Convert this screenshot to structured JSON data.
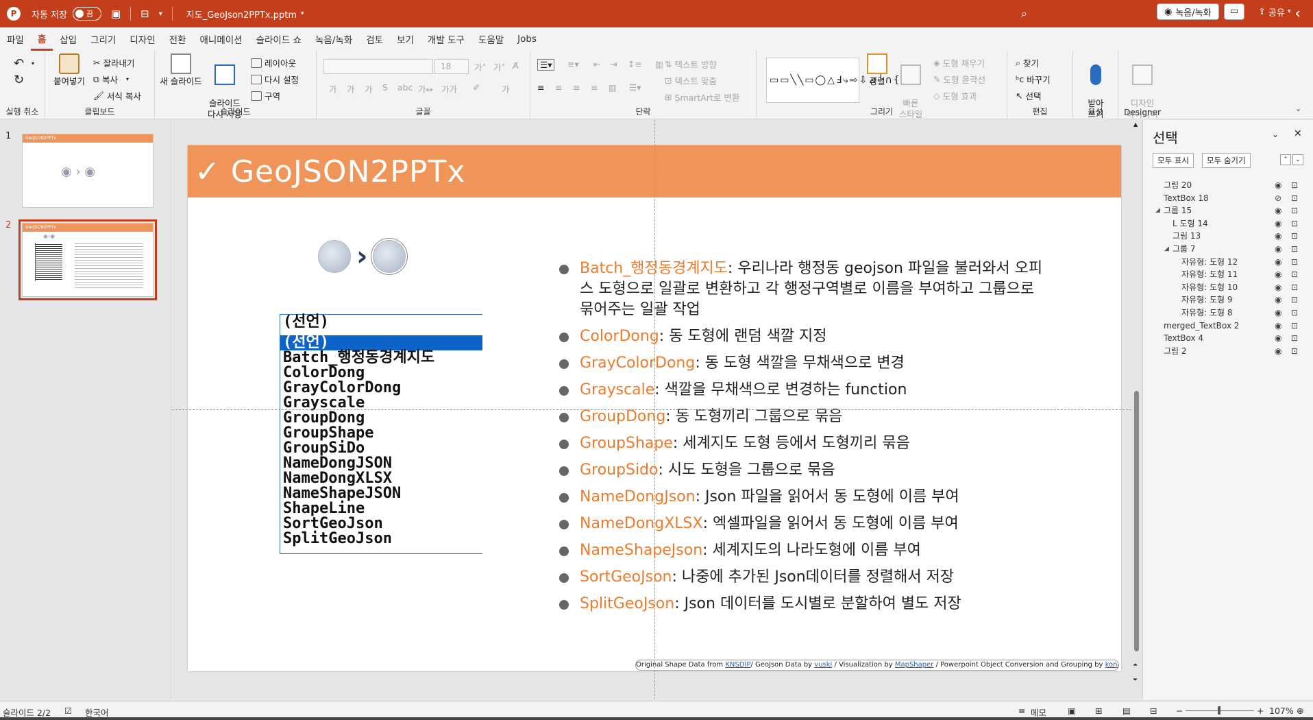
{
  "titlebar": {
    "autosave_label": "자동 저장",
    "toggle_state": "끔",
    "filename": "지도_GeoJson2PPTx.pptm"
  },
  "menu": {
    "tabs": [
      "파일",
      "홈",
      "삽입",
      "그리기",
      "디자인",
      "전환",
      "애니메이션",
      "슬라이드 쇼",
      "녹음/녹화",
      "검토",
      "보기",
      "개발 도구",
      "도움말",
      "Jobs"
    ],
    "active": "홈",
    "record_button": "녹음/녹화",
    "share_button": "공유"
  },
  "ribbon": {
    "undo_group": "실행 취소",
    "clipboard": {
      "label": "클립보드",
      "paste": "붙여넣기",
      "cut": "잘라내기",
      "copy": "복사",
      "format_painter": "서식 복사"
    },
    "slides": {
      "label": "슬라이드",
      "new_slide": "새 슬라이드",
      "reuse": "슬라이드\n다시 사용",
      "layout": "레이아웃",
      "reset": "다시 설정",
      "section": "구역"
    },
    "font": {
      "label": "글꼴",
      "size": "18"
    },
    "paragraph": {
      "label": "단락",
      "text_direction": "텍스트 방향",
      "align_text": "텍스트 맞춤",
      "smartart": "SmartArt로 변환"
    },
    "drawing": {
      "label": "그리기",
      "arrange": "정렬",
      "quick_styles": "빠른\n스타일",
      "fill": "도형 채우기",
      "outline": "도형 윤곽선",
      "effects": "도형 효과"
    },
    "editing": {
      "label": "편집",
      "find": "찾기",
      "replace": "바꾸기",
      "select": "선택"
    },
    "voice": {
      "label": "음성",
      "dictate": "받아\n쓰기"
    },
    "designer": {
      "label": "Designer",
      "ideas": "디자인\n아이디어"
    }
  },
  "thumbnails": [
    {
      "number": "1",
      "title": "GeoJSON2PPTx"
    },
    {
      "number": "2",
      "title": "GeoJSON2PPTx"
    }
  ],
  "slide": {
    "title": "✓ GeoJSON2PPTx",
    "listbox": [
      "(선언)",
      "(선언)",
      "Batch_행정동경계지도",
      "ColorDong",
      "GrayColorDong",
      "Grayscale",
      "GroupDong",
      "GroupShape",
      "GroupSiDo",
      "NameDongJSON",
      "NameDongXLSX",
      "NameShapeJSON",
      "ShapeLine",
      "SortGeoJson",
      "SplitGeoJson"
    ],
    "bullets": [
      {
        "key": "Batch_행정동경계지도",
        "text": ": 우리나라 행정동 geojson 파일을 불러와서 오피스 도형으로 일괄로 변환하고 각 행정구역별로 이름을 부여하고 그룹으로 묶어주는 일괄 작업"
      },
      {
        "key": "ColorDong",
        "text": ": 동 도형에 랜덤 색깔 지정"
      },
      {
        "key": "GrayColorDong",
        "text": ": 동 도형 색깔을 무채색으로 변경"
      },
      {
        "key": "Grayscale",
        "text": ": 색깔을 무채색으로 변경하는 function"
      },
      {
        "key": "GroupDong",
        "text": ": 동 도형끼리 그룹으로 묶음"
      },
      {
        "key": "GroupShape",
        "text": ": 세계지도 도형 등에서 도형끼리 묶음"
      },
      {
        "key": "GroupSido",
        "text": ": 시도 도형을 그룹으로 묶음"
      },
      {
        "key": "NameDongJson",
        "text": ": Json 파일을 읽어서 동 도형에 이름 부여"
      },
      {
        "key": "NameDongXLSX",
        "text": ": 엑셀파일을 읽어서 동 도형에 이름 부여"
      },
      {
        "key": "NameShapeJson",
        "text": ": 세계지도의 나라도형에 이름 부여"
      },
      {
        "key": "SortGeoJson",
        "text": ": 나중에 추가된 Json데이터를 정렬해서 저장"
      },
      {
        "key": "SplitGeoJson",
        "text": ": Json 데이터를 도시별로 분할하여 별도 저장"
      }
    ],
    "credit": {
      "prefix": "Original Shape Data from",
      "l1": "KNSDIP",
      "mid1": "/ GeoJson Data by",
      "l2": "vuski",
      "mid2": "/ Visualization  by",
      "l3": "MapShaper",
      "mid3": "/ Powerpoint Object Conversion and Grouping  by",
      "l4": "konahn"
    }
  },
  "selection_pane": {
    "title": "선택",
    "show_all": "모두 표시",
    "hide_all": "모두 숨기기",
    "items": [
      {
        "name": "그림 20",
        "indent": 0,
        "visible": true
      },
      {
        "name": "TextBox 18",
        "indent": 0,
        "visible": false
      },
      {
        "name": "그룹 15",
        "indent": 0,
        "visible": true,
        "expanded": true
      },
      {
        "name": "L 도형 14",
        "indent": 1,
        "visible": true
      },
      {
        "name": "그림 13",
        "indent": 1,
        "visible": true
      },
      {
        "name": "그룹 7",
        "indent": 1,
        "visible": true,
        "expanded": true
      },
      {
        "name": "자유형: 도형 12",
        "indent": 2,
        "visible": true
      },
      {
        "name": "자유형: 도형 11",
        "indent": 2,
        "visible": true
      },
      {
        "name": "자유형: 도형 10",
        "indent": 2,
        "visible": true
      },
      {
        "name": "자유형: 도형 9",
        "indent": 2,
        "visible": true
      },
      {
        "name": "자유형: 도형 8",
        "indent": 2,
        "visible": true
      },
      {
        "name": "merged_TextBox 2",
        "indent": 0,
        "visible": true
      },
      {
        "name": "TextBox 4",
        "indent": 0,
        "visible": true
      },
      {
        "name": "그림 2",
        "indent": 0,
        "visible": true
      }
    ]
  },
  "status": {
    "slide": "슬라이드 2/2",
    "language": "한국어",
    "notes": "메모",
    "zoom": "107%"
  }
}
